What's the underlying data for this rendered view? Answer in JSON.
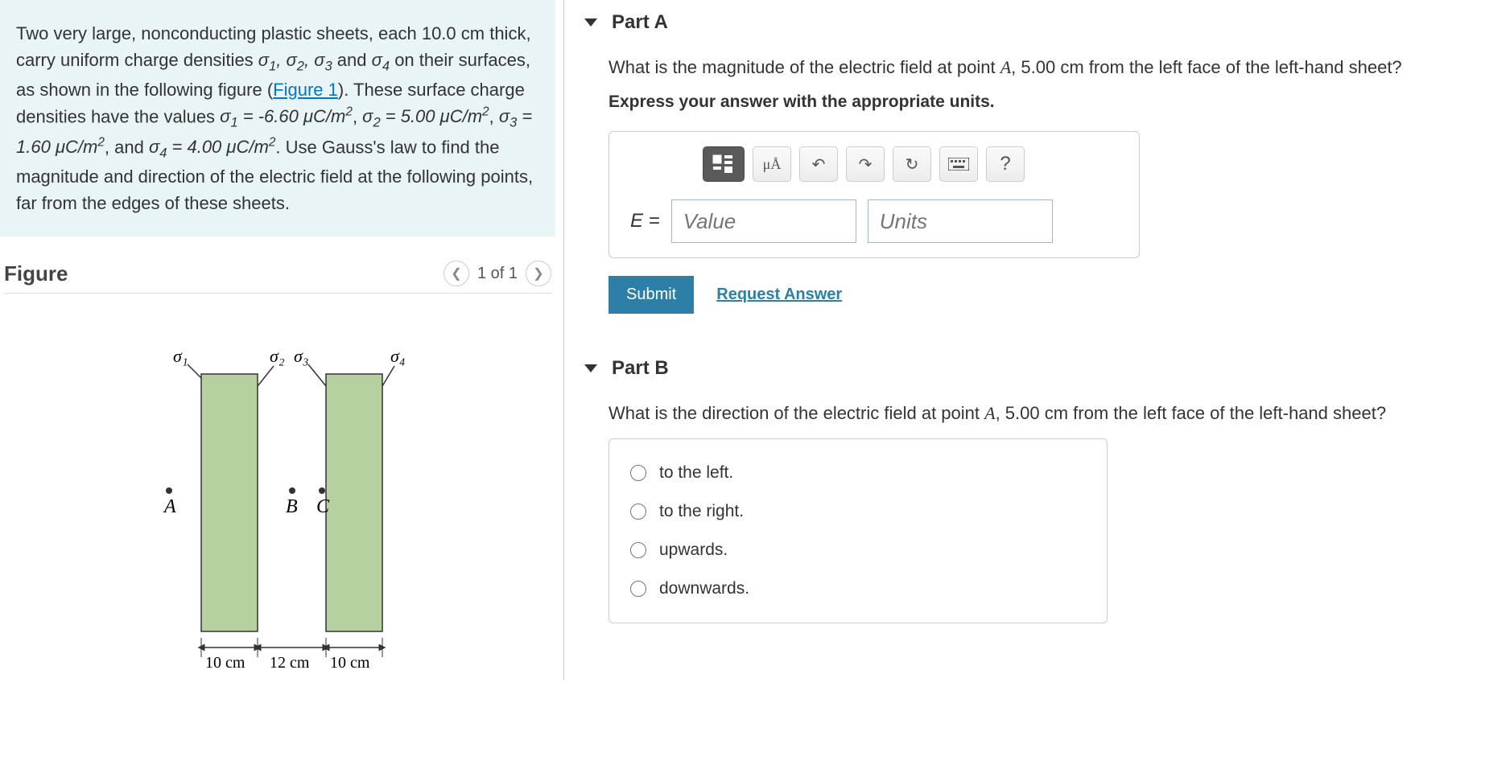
{
  "problem": {
    "intro_pre": "Two very large, nonconducting plastic sheets, each 10.0 cm thick, carry uniform charge densities ",
    "intro_mid": " on their surfaces, as shown in the following figure (",
    "figure_link": "Figure 1",
    "intro_post1": "). These surface charge densities have the values ",
    "s1": "σ₁ = -6.60 μC/m²",
    "s2": "σ₂ = 5.00 μC/m²",
    "s3": "σ₃ = 1.60 μC/m²",
    "s4": "σ₄ = 4.00 μC/m²",
    "intro_post2": ". Use Gauss's law to find the magnitude and direction of the electric field at the following points, far from the edges of these sheets."
  },
  "figure": {
    "title": "Figure",
    "nav": "1 of 1",
    "labels": {
      "s1": "σ₁",
      "s2": "σ₂",
      "s3": "σ₃",
      "s4": "σ₄",
      "A": "A",
      "B": "B",
      "C": "C",
      "d1": "10 cm",
      "d2": "12 cm",
      "d3": "10 cm"
    }
  },
  "partA": {
    "title": "Part A",
    "question_pre": "What is the magnitude of the electric field at point ",
    "point_label": "A",
    "question_post": ", 5.00 cm from the left face of the left-hand sheet?",
    "instruction": "Express your answer with the appropriate units.",
    "units_btn": "μÅ",
    "help_btn": "?",
    "e_label": "E =",
    "value_ph": "Value",
    "units_ph": "Units",
    "submit": "Submit",
    "request": "Request Answer"
  },
  "partB": {
    "title": "Part B",
    "question_pre": "What is the direction of the electric field at point ",
    "point_label": "A",
    "question_post": ", 5.00 cm from the left face of the left-hand sheet?",
    "choices": [
      "to the left.",
      "to the right.",
      "upwards.",
      "downwards."
    ]
  }
}
